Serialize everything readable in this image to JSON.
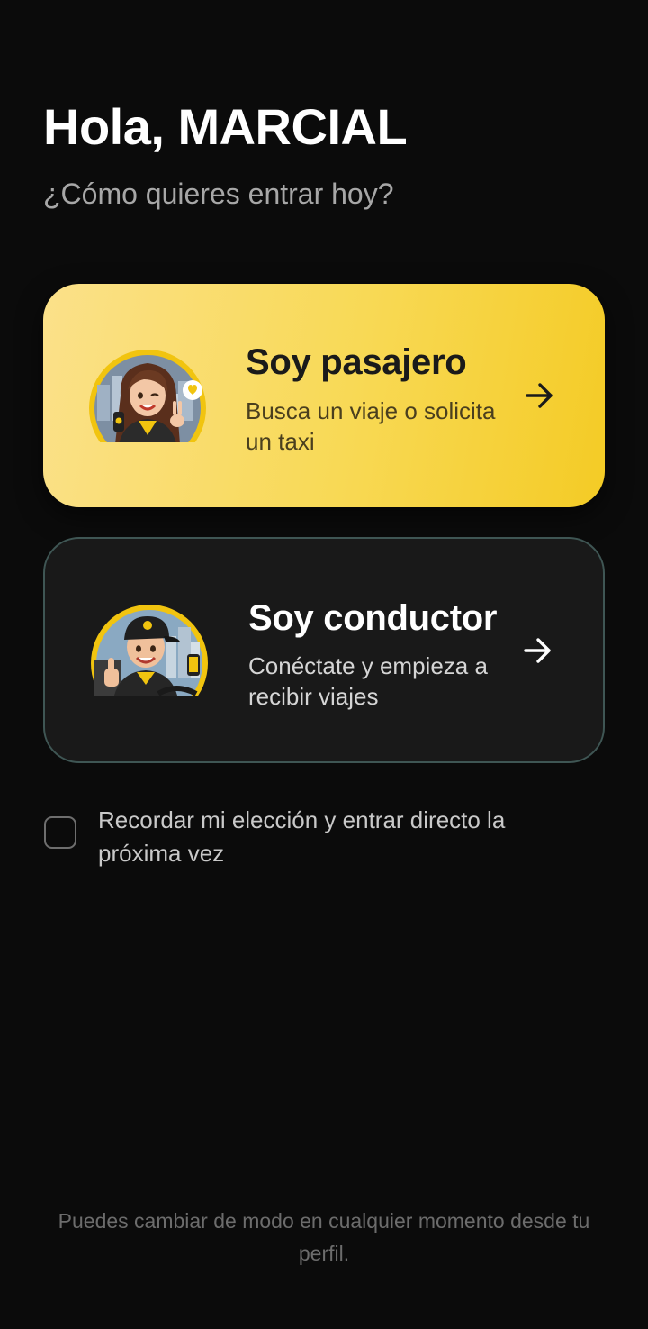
{
  "header": {
    "greeting": "Hola, MARCIAL",
    "subtitle": "¿Cómo quieres entrar hoy?"
  },
  "options": {
    "passenger": {
      "title": "Soy pasajero",
      "description": "Busca un viaje o solicita un taxi",
      "avatar": "passenger-avatar",
      "arrow_icon": "arrow-right-icon",
      "background": "#F8D955",
      "text_color": "#1A1A1A"
    },
    "driver": {
      "title": "Soy conductor",
      "description": "Conéctate y empieza a recibir viajes",
      "avatar": "driver-avatar",
      "arrow_icon": "arrow-right-icon",
      "background": "#191919",
      "border_color": "#3F5654",
      "text_color": "#FFFFFF"
    }
  },
  "remember": {
    "label": "Recordar mi elección y entrar directo la próxima vez",
    "checked": false
  },
  "footer": {
    "note": "Puedes cambiar de modo en cualquier momento desde tu perfil."
  },
  "colors": {
    "background": "#0B0B0B",
    "accent_yellow": "#F4CB25",
    "subtitle": "#A7A7A7",
    "muted": "#6C6C6C"
  }
}
